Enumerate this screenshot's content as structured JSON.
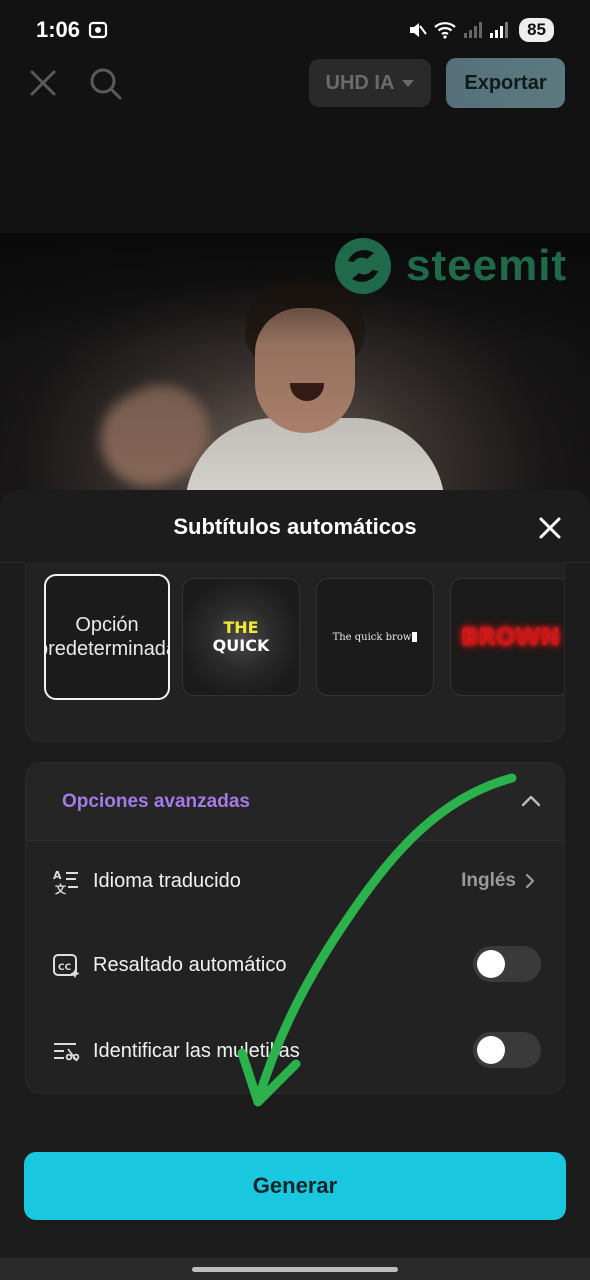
{
  "status_bar": {
    "time": "1:06",
    "battery": "85"
  },
  "toolbar": {
    "quality_label": "UHD IA",
    "export_label": "Exportar"
  },
  "video": {
    "watermark_text": "steemit"
  },
  "sheet": {
    "title": "Subtítulos automáticos",
    "styles": [
      {
        "label": "Opción predeterminada",
        "selected": true
      },
      {
        "preview_line1": "THE",
        "preview_line2": "QUICK"
      },
      {
        "preview": "The quick brow"
      },
      {
        "preview": "BROWN"
      }
    ],
    "advanced": {
      "title": "Opciones avanzadas",
      "rows": [
        {
          "label": "Idioma traducido",
          "value": "Inglés",
          "icon": "translate-icon"
        },
        {
          "label": "Resaltado automático",
          "toggle": false,
          "icon": "cc-sparkle-icon"
        },
        {
          "label": "Identificar las muletillas",
          "toggle": false,
          "icon": "filler-words-icon"
        }
      ]
    },
    "generate_label": "Generar"
  },
  "colors": {
    "accent_cyan": "#19c8de",
    "advanced_purple": "#a47be6",
    "annotation_green": "#2bb24c",
    "steemit_green": "#1f6a4a"
  }
}
